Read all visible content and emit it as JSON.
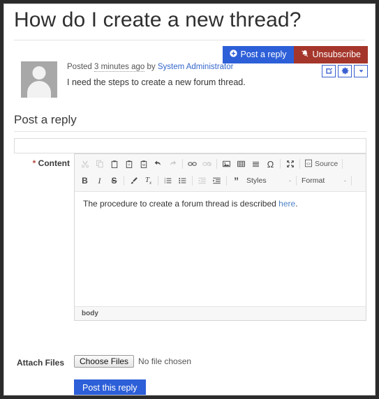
{
  "thread": {
    "title": "How do I create a new thread?",
    "post": {
      "posted_prefix": "Posted",
      "timestamp": "3 minutes ago",
      "by_word": "by",
      "author": "System Administrator",
      "body": "I need the steps to create a new forum thread."
    }
  },
  "actions": {
    "post_reply_label": "Post a reply",
    "unsubscribe_label": "Unsubscribe",
    "primary_color": "#2d5fd8",
    "danger_color": "#a5362b",
    "icon_buttons": [
      {
        "name": "edit-icon",
        "title": "Edit"
      },
      {
        "name": "gear-icon",
        "title": "Settings"
      },
      {
        "name": "chevron-down-icon",
        "title": "More"
      }
    ]
  },
  "reply_form": {
    "section_title": "Post a reply",
    "subject": {
      "value": "",
      "placeholder": ""
    },
    "content_label": "Content",
    "required_marker": "*",
    "attach_label": "Attach Files",
    "choose_files_label": "Choose Files",
    "no_file_label": "No file chosen",
    "submit_label": "Post this reply"
  },
  "editor": {
    "status_path": "body",
    "content_text": "The procedure to create a forum thread is described ",
    "content_link": "here",
    "content_tail": ".",
    "toolbar_row1": [
      {
        "name": "cut-icon",
        "glyph": "✂",
        "disabled": true
      },
      {
        "name": "copy-icon",
        "glyph": "⧉",
        "disabled": true
      },
      {
        "name": "paste-icon",
        "glyph": "ὌB",
        "disabled": false
      },
      {
        "name": "paste-text-icon",
        "glyph": "T",
        "disabled": false
      },
      {
        "name": "paste-word-icon",
        "glyph": "W",
        "disabled": false
      },
      {
        "name": "undo-icon",
        "glyph": "↩",
        "disabled": false
      },
      {
        "name": "redo-icon",
        "glyph": "↪",
        "disabled": true
      },
      {
        "name": "link-icon",
        "glyph": "∞",
        "disabled": false
      },
      {
        "name": "unlink-icon",
        "glyph": "∞",
        "disabled": true
      },
      {
        "name": "image-icon",
        "glyph": "ὛC",
        "disabled": false
      },
      {
        "name": "table-icon",
        "glyph": "▦",
        "disabled": false
      },
      {
        "name": "horizontal-rule-icon",
        "glyph": "≡",
        "disabled": false
      },
      {
        "name": "special-char-icon",
        "glyph": "Ω",
        "disabled": false
      },
      {
        "name": "maximize-icon",
        "glyph": "⤢",
        "disabled": false
      }
    ],
    "source_label": "Source",
    "toolbar_row2": [
      {
        "name": "bold-icon",
        "glyph": "B",
        "disabled": false
      },
      {
        "name": "italic-icon",
        "glyph": "I",
        "disabled": false
      },
      {
        "name": "strikethrough-icon",
        "glyph": "S",
        "disabled": false
      },
      {
        "name": "format-brush-icon",
        "glyph": "✒",
        "disabled": false
      },
      {
        "name": "remove-format-icon",
        "glyph": "Tx",
        "disabled": false
      },
      {
        "name": "numbered-list-icon",
        "glyph": "☰",
        "disabled": false
      },
      {
        "name": "bulleted-list-icon",
        "glyph": "☰",
        "disabled": false
      },
      {
        "name": "outdent-icon",
        "glyph": "⬅",
        "disabled": true
      },
      {
        "name": "indent-icon",
        "glyph": "➡",
        "disabled": false
      },
      {
        "name": "blockquote-icon",
        "glyph": "”",
        "disabled": false
      }
    ],
    "styles_label": "Styles",
    "format_label": "Format",
    "combo_caret": "-"
  }
}
